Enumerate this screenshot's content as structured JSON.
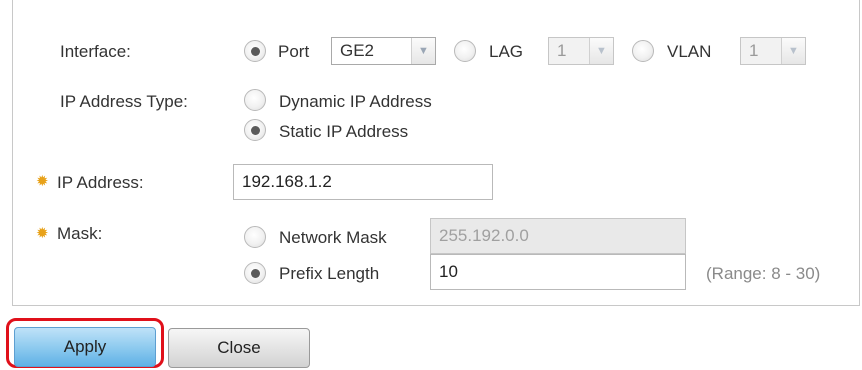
{
  "form": {
    "interface": {
      "label": "Interface:",
      "options": {
        "port": {
          "label": "Port",
          "checked": true,
          "value": "GE2"
        },
        "lag": {
          "label": "LAG",
          "checked": false,
          "value": "1"
        },
        "vlan": {
          "label": "VLAN",
          "checked": false,
          "value": "1"
        }
      }
    },
    "ip_address_type": {
      "label": "IP Address Type:",
      "options": [
        {
          "label": "Dynamic IP Address",
          "checked": false
        },
        {
          "label": "Static IP Address",
          "checked": true
        }
      ]
    },
    "ip_address": {
      "label": "IP Address:",
      "value": "192.168.1.2",
      "required": true
    },
    "mask": {
      "label": "Mask:",
      "required": true,
      "network_mask": {
        "label": "Network Mask",
        "checked": false,
        "value": "255.192.0.0"
      },
      "prefix_length": {
        "label": "Prefix Length",
        "checked": true,
        "value": "10",
        "range": "(Range: 8 - 30)"
      }
    }
  },
  "buttons": {
    "apply": "Apply",
    "close": "Close"
  },
  "icons": {
    "required": "required-asterisk-icon",
    "dropdown": "chevron-down-icon"
  },
  "colors": {
    "required_icon": "#e8a21a",
    "apply_button": "#8fcbef",
    "highlight": "#e0101a"
  }
}
